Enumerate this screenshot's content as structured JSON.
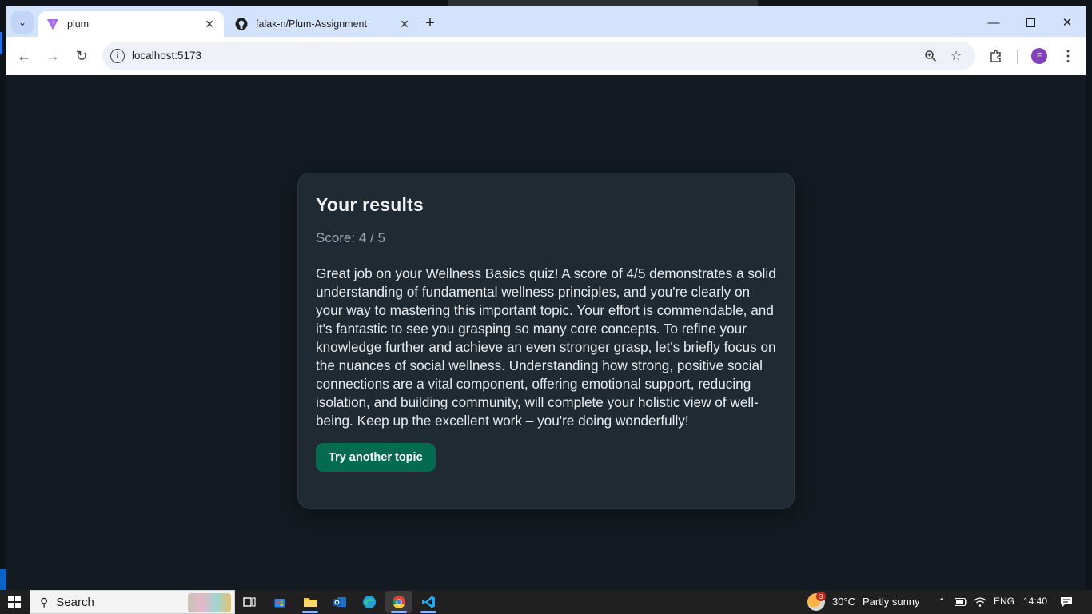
{
  "browser": {
    "tabs": [
      {
        "title": "plum",
        "active": true,
        "favicon": "vite-logo-icon"
      },
      {
        "title": "falak-n/Plum-Assignment",
        "active": false,
        "favicon": "github-icon"
      }
    ],
    "new_tab": "+",
    "url": "localhost:5173",
    "profile_initial": "F"
  },
  "results": {
    "title": "Your results",
    "score": "Score: 4 / 5",
    "summary": "Great job on your Wellness Basics quiz! A score of 4/5 demonstrates a solid understanding of fundamental wellness principles, and you're clearly on your way to mastering this important topic. Your effort is commendable, and it's fantastic to see you grasping so many core concepts. To refine your knowledge further and achieve an even stronger grasp, let's briefly focus on the nuances of social wellness. Understanding how strong, positive social connections are a vital component, offering emotional support, reducing isolation, and building community, will complete your holistic view of well-being. Keep up the excellent work – you're doing wonderfully!",
    "button_label": "Try another topic"
  },
  "taskbar": {
    "search_label": "Search",
    "weather_badge": "3",
    "weather": "30°C",
    "weather_desc": "Partly sunny",
    "language": "ENG",
    "time": "14:40"
  },
  "colors": {
    "page_bg": "#131a21",
    "card_bg": "#1f2a33",
    "button_bg": "#046a50",
    "tab_strip": "#d3e3fd"
  }
}
